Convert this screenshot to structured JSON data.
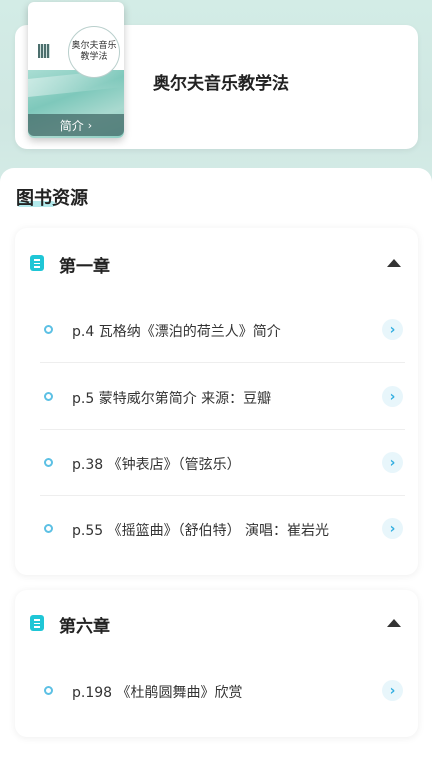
{
  "book": {
    "title": "奥尔夫音乐教学法",
    "intro_label": "简介",
    "intro_chevron": "›",
    "cover": {
      "circle_line1": "奥尔夫音乐",
      "circle_line2": "教学法"
    }
  },
  "resources": {
    "section_title": "图书资源",
    "chapters": [
      {
        "title": "第一章",
        "items": [
          {
            "label": "p.4 瓦格纳《漂泊的荷兰人》简介"
          },
          {
            "label": "p.5 蒙特威尔第简介 来源：豆瓣"
          },
          {
            "label": "p.38 《钟表店》（管弦乐）"
          },
          {
            "label": "p.55 《摇篮曲》（舒伯特） 演唱：崔岩光"
          }
        ]
      },
      {
        "title": "第六章",
        "items": [
          {
            "label": "p.198 《杜鹃圆舞曲》欣赏"
          }
        ]
      }
    ]
  },
  "icons": {
    "item_arrow": "›",
    "expand": "chevron-up-icon",
    "chapter": "list-icon"
  },
  "colors": {
    "accent": "#1fc6d6",
    "dot": "#5cc0e4",
    "header_bg": "#cfe9e4"
  }
}
